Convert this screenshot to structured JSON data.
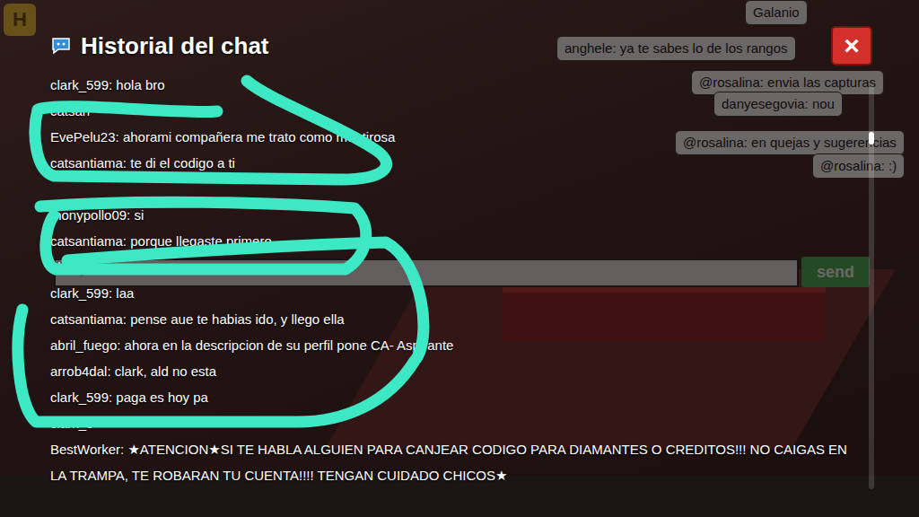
{
  "logo": "H",
  "chat_history": {
    "title": "Historial del chat",
    "close": "×",
    "scroll_level": 0.12,
    "lines": [
      {
        "text": "clark_599: hola bro"
      },
      {
        "text": "catsan"
      },
      {
        "text": "EvePelu23: ahorami compañera me trato como mentirosa"
      },
      {
        "text": "catsantiama: te di el codigo a ti"
      },
      {
        "text": ""
      },
      {
        "text": "thonypollo09: si"
      },
      {
        "text": "catsantiama: porque llegaste primero"
      },
      {
        "text": "nlaury!!!:"
      },
      {
        "text": "clark_599: laa"
      },
      {
        "text": "catsantiama: pense aue te habias ido, y llego ella"
      },
      {
        "text": "abril_fuego: ahora en la descripcion de su perfil pone CA- Aspirante"
      },
      {
        "text": "arrob4dal: clark, ald no esta"
      },
      {
        "text": "clark_599: paga es hoy pa"
      },
      {
        "text": "clark_5"
      },
      {
        "text": "BestWorker: ★ATENCION★SI TE HABLA ALGUIEN PARA CANJEAR CODIGO PARA DIAMANTES O CREDITOS!!! NO CAIGAS EN LA TRAMPA, TE ROBARAN TU CUENTA!!!! TENGAN CUIDADO CHICOS★"
      }
    ]
  },
  "room_bubbles": [
    {
      "text": "Galanio"
    },
    {
      "text": "anghele: ya te sabes lo de los rangos"
    },
    {
      "text": "@rosalina: envia las capturas"
    },
    {
      "text": "danyesegovia: nou"
    },
    {
      "text": "@rosalina: en quejas y sugerencias"
    },
    {
      "text": "@rosalina: :)"
    }
  ],
  "chat_input": {
    "send": "send"
  }
}
